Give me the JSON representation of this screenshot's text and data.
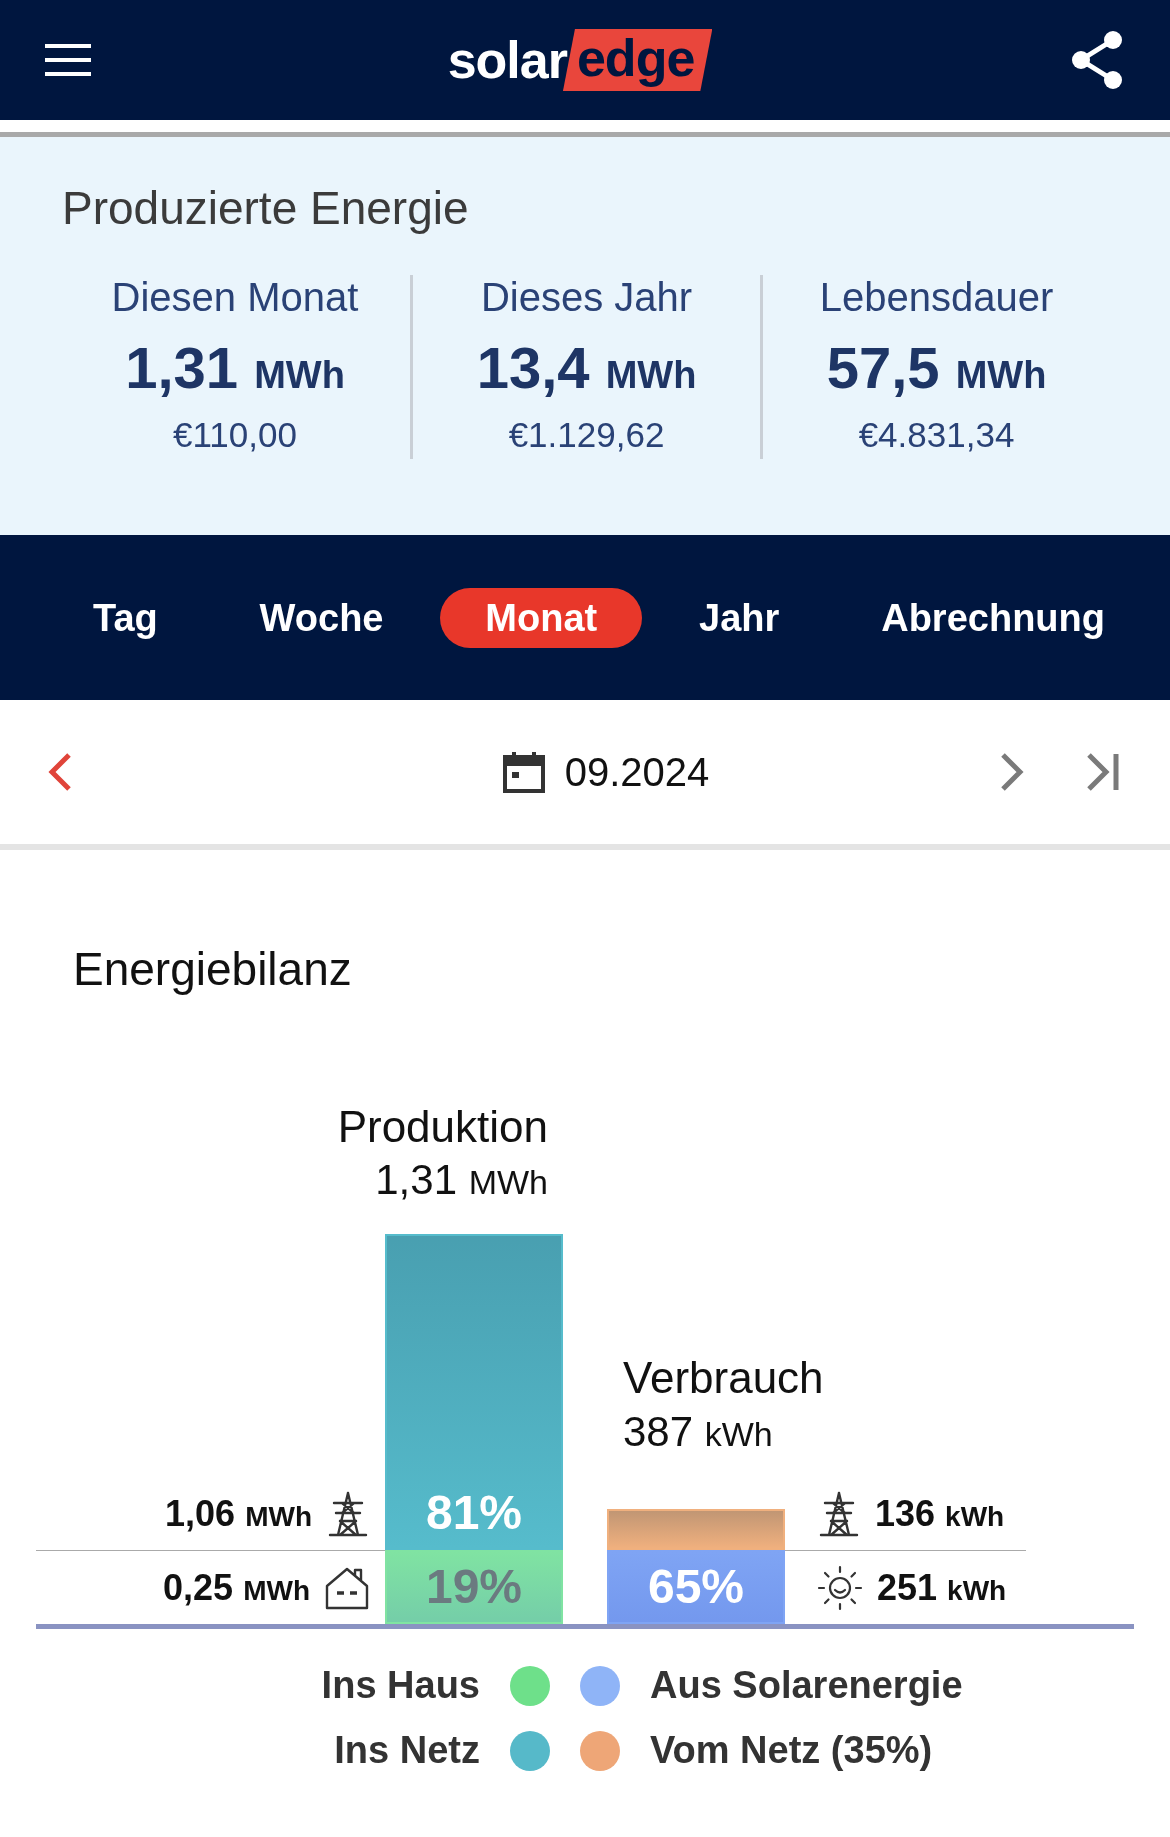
{
  "header": {
    "logo_left": "solar",
    "logo_right": "edge"
  },
  "summary": {
    "title": "Produzierte Energie",
    "periods": [
      {
        "label": "Diesen Monat",
        "value": "1,31",
        "unit": "MWh",
        "money": "€110,00"
      },
      {
        "label": "Dieses Jahr",
        "value": "13,4",
        "unit": "MWh",
        "money": "€1.129,62"
      },
      {
        "label": "Lebensdauer",
        "value": "57,5",
        "unit": "MWh",
        "money": "€4.831,34"
      }
    ]
  },
  "tabs": [
    {
      "label": "Tag",
      "selected": false
    },
    {
      "label": "Woche",
      "selected": false
    },
    {
      "label": "Monat",
      "selected": true
    },
    {
      "label": "Jahr",
      "selected": false
    },
    {
      "label": "Abrechnung",
      "selected": false
    }
  ],
  "date_nav": {
    "date": "09.2024"
  },
  "energy_balance": {
    "title": "Energiebilanz",
    "production": {
      "title": "Produktion",
      "value": "1,31",
      "unit": "MWh",
      "segments": [
        {
          "percent": "81%",
          "color": "#56bccc"
        },
        {
          "percent": "19%",
          "color": "#80e3a2"
        }
      ]
    },
    "consumption": {
      "title": "Verbrauch",
      "value": "387",
      "unit": "kWh",
      "segments": [
        {
          "color": "#f0b07e"
        },
        {
          "percent": "65%",
          "color": "#7fa4f4"
        }
      ]
    },
    "left_flows": [
      {
        "value": "1,06",
        "unit": "MWh",
        "kind": "grid"
      },
      {
        "value": "0,25",
        "unit": "MWh",
        "kind": "home"
      }
    ],
    "right_flows": [
      {
        "value": "136",
        "unit": "kWh",
        "kind": "grid"
      },
      {
        "value": "251",
        "unit": "kWh",
        "kind": "solar"
      }
    ],
    "legend": {
      "left": [
        {
          "label": "Ins Haus",
          "color": "#6ee08a"
        },
        {
          "label": "Ins Netz",
          "color": "#56b9c9"
        }
      ],
      "right": [
        {
          "label": "Aus Solarenergie",
          "color": "#8fb4f7"
        },
        {
          "label": "Vom Netz (35%)",
          "color": "#eea677"
        }
      ]
    }
  }
}
